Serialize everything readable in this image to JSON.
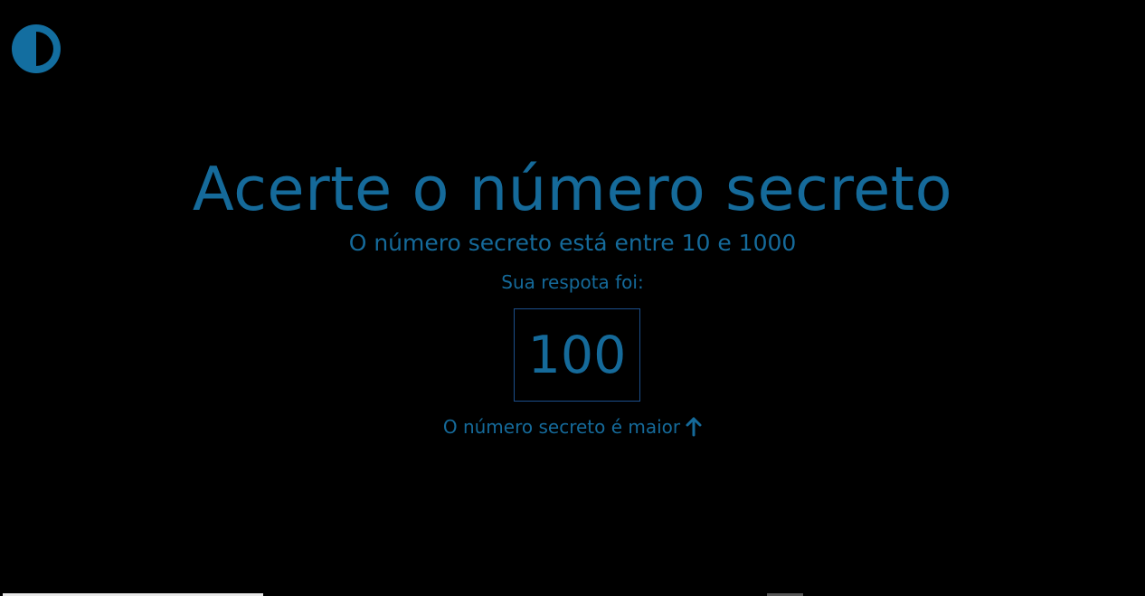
{
  "theme_toggle": {
    "icon": "contrast-icon",
    "color": "#136ea0"
  },
  "main": {
    "title": "Acerte o número secreto",
    "subtitle": "O número secreto está entre 10 e 1000",
    "answer_label": "Sua respota foi:",
    "answer_value": "100",
    "hint_text": "O número secreto é maior",
    "hint_icon": "arrow-up-icon"
  },
  "colors": {
    "background": "#000000",
    "accent": "#156a9a",
    "box_border": "#1c4f8c"
  }
}
